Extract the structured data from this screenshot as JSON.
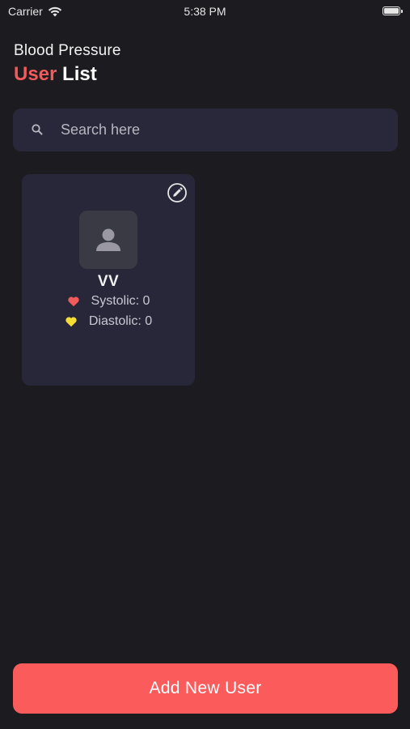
{
  "status_bar": {
    "carrier": "Carrier",
    "time": "5:38 PM",
    "wifi_icon": "wifi-icon",
    "battery_icon": "battery-icon"
  },
  "header": {
    "subtitle": "Blood Pressure",
    "title_accent": "User",
    "title_main": "List"
  },
  "search": {
    "placeholder": "Search here",
    "value": "",
    "icon": "search-icon"
  },
  "users": [
    {
      "name": "VV",
      "systolic_label": "Systolic: 0",
      "diastolic_label": "Diastolic: 0",
      "avatar_icon": "person-icon",
      "edit_icon": "pencil-icon"
    }
  ],
  "footer": {
    "add_button_label": "Add New User"
  },
  "colors": {
    "background": "#1c1b20",
    "card": "#28273a",
    "accent": "#f35b5b",
    "button": "#fc5b5b",
    "systolic_heart": "#f35b5b",
    "diastolic_heart": "#f5dd33"
  }
}
